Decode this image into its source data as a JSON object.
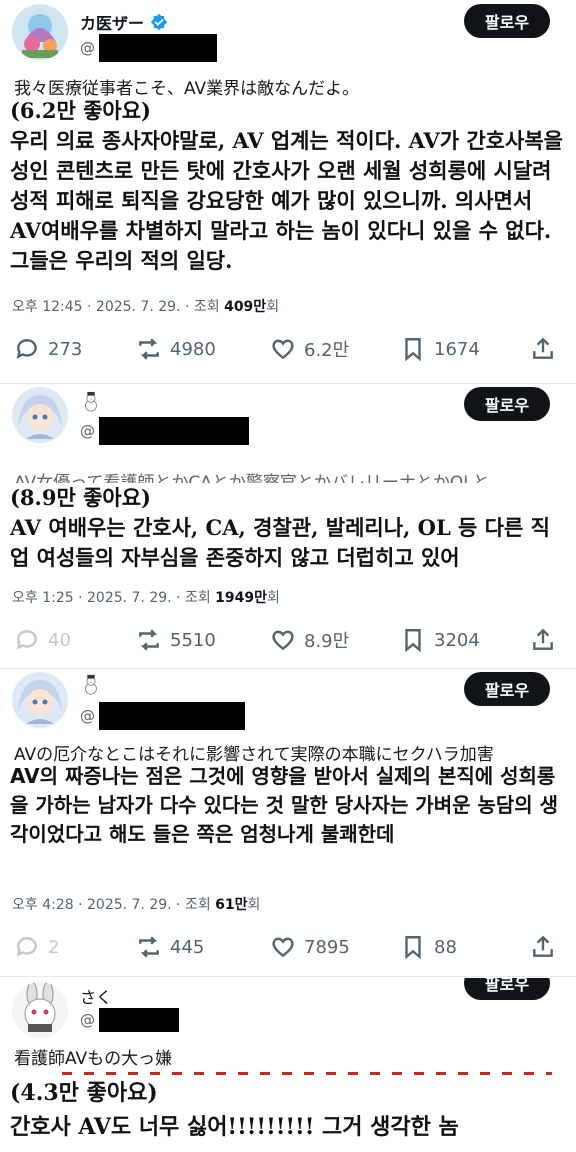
{
  "posts": [
    {
      "name": "カ医ザー",
      "handle": "@",
      "follow": "팔로우",
      "jp_text": "我々医療従事者こそ、AV業界は敵なんだよ。",
      "ko_likes": "(6.2만 좋아요)",
      "ko_text": "우리 의료 종사자야말로, AV 업계는 적이다. AV가 간호사복을 성인 콘텐츠로 만든 탓에 간호사가 오랜 세월 성희롱에 시달려 성적 피해로 퇴직을 강요당한 예가 많이 있으니까. 의사면서 AV여배우를 차별하지 말라고 하는 놈이 있다니 있을 수 없다. 그들은 우리의 적의 일당.",
      "meta_time": "오후 12:45 · 2025. 7. 29. · 조회 ",
      "meta_views": "409만",
      "meta_suffix": "회",
      "replies": "273",
      "reposts": "4980",
      "likes": "6.2만",
      "bookmarks": "1674"
    },
    {
      "name": "",
      "handle": "@",
      "follow": "팔로우",
      "jp_text": "AV女優って看護師とかCAとか警察官とかバレリーナとかOLと",
      "ko_likes": "(8.9만 좋아요)",
      "ko_text": "AV 여배우는 간호사, CA, 경찰관, 발레리나, OL 등 다른 직업 여성들의 자부심을 존중하지 않고 더럽히고 있어",
      "meta_time": "오후 1:25 · 2025. 7. 29. · 조회 ",
      "meta_views": "1949만",
      "meta_suffix": "회",
      "replies": "40",
      "reposts": "5510",
      "likes": "8.9만",
      "bookmarks": "3204"
    },
    {
      "name": "",
      "handle": "@",
      "follow": "팔로우",
      "jp_text": "AVの厄介なとこはそれに影響されて実際の本職にセクハラ加害",
      "ko_likes": "",
      "ko_text": "AV의 짜증나는 점은 그것에 영향을 받아서 실제의 본직에 성희롱을 가하는 남자가 다수 있다는 것 말한 당사자는 가벼운 농담의 생각이었다고 해도 들은 쪽은 엄청나게 불쾌한데",
      "meta_time": "오후 4:28 · 2025. 7. 29. · 조회 ",
      "meta_views": "61만",
      "meta_suffix": "회",
      "replies": "2",
      "reposts": "445",
      "likes": "7895",
      "bookmarks": "88"
    },
    {
      "name": "さく",
      "handle": "@",
      "follow": "팔로우",
      "jp_text": "看護師AVもの大っ嫌",
      "ko_likes": "(4.3만 좋아요)",
      "ko_text": "간호사 AV도 너무 싫어!!!!!!!!! 그거 생각한 놈"
    }
  ],
  "colors": {
    "follow_bg": "#0f1419",
    "text_gray": "#536471",
    "verified": "#1d9bf0",
    "accent_red": "#c62828"
  }
}
